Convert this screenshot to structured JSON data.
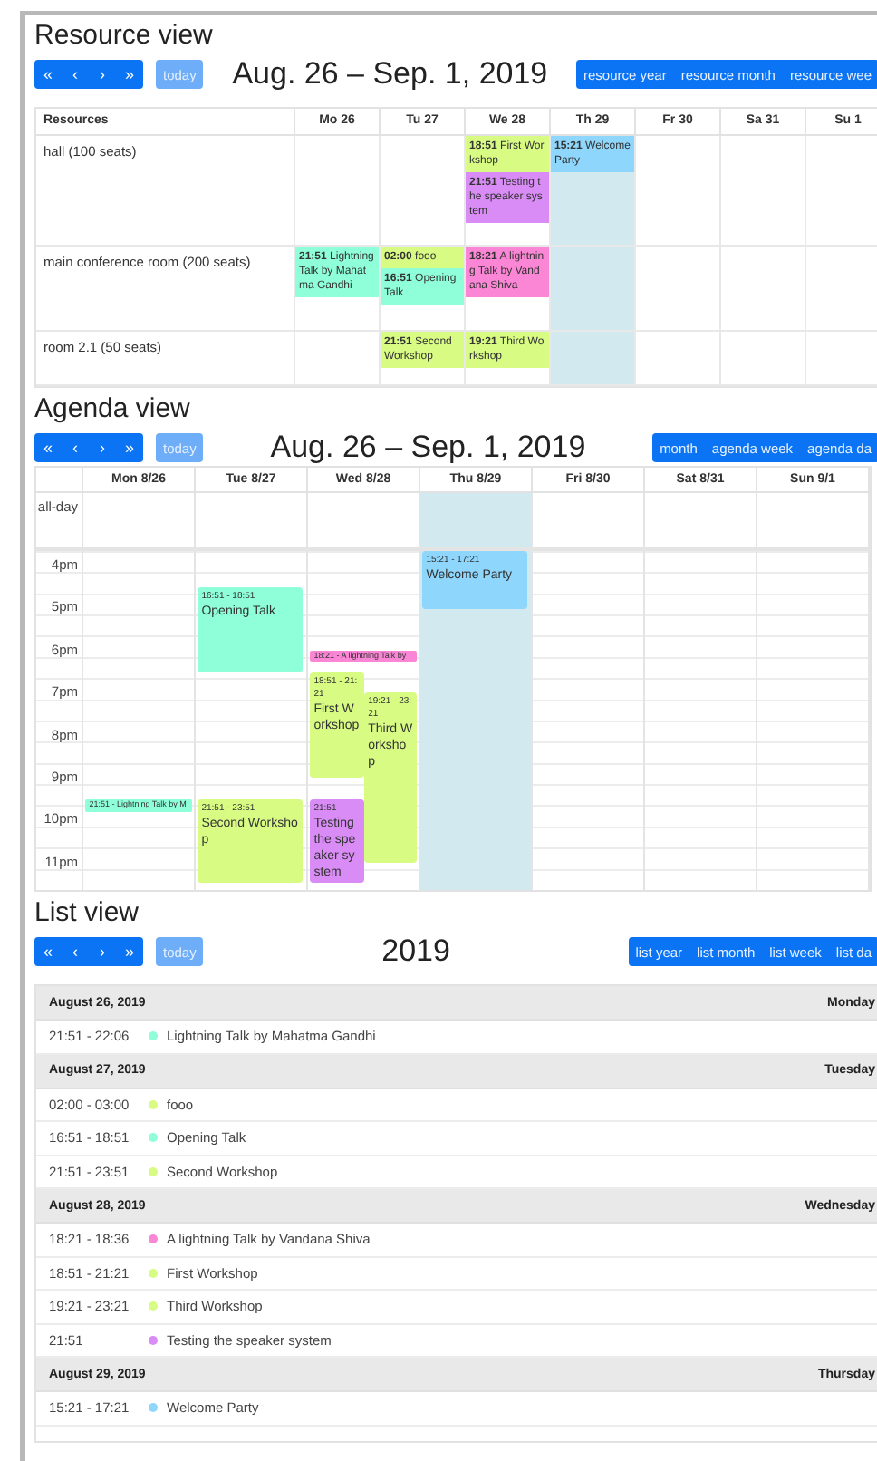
{
  "resource_view": {
    "title": "Resource view",
    "nav_buttons": [
      "«",
      "‹",
      "›",
      "»"
    ],
    "today_button": {
      "label": "today",
      "disabled": true
    },
    "date_range": "Aug. 26 – Sep. 1, 2019",
    "view_buttons": [
      {
        "label": "resource year",
        "selected": false
      },
      {
        "label": "resource month",
        "selected": false
      },
      {
        "label": "resource wee",
        "selected": false
      }
    ],
    "table": {
      "resource_header": "Resources",
      "days": [
        {
          "label": "Mo 26",
          "today": false
        },
        {
          "label": "Tu 27",
          "today": false
        },
        {
          "label": "We 28",
          "today": false
        },
        {
          "label": "Th 29",
          "today": true
        },
        {
          "label": "Fr 30",
          "today": false
        },
        {
          "label": "Sa 31",
          "today": false
        },
        {
          "label": "Su 1",
          "today": false
        }
      ],
      "rows": [
        {
          "resource": "hall (100 seats)",
          "cells": [
            {},
            {},
            {
              "events": [
                {
                  "time": "18:51",
                  "title": "First Workshop",
                  "color": "#d8fb84"
                },
                {
                  "time": "21:51",
                  "title": "Testing the speaker system",
                  "color": "#d98cf5"
                }
              ]
            },
            {
              "events": [
                {
                  "time": "15:21",
                  "title": "Welcome Party",
                  "color": "#8ed6fb"
                }
              ]
            },
            {},
            {},
            {}
          ]
        },
        {
          "resource": "main conference room (200 seats)",
          "cells": [
            {
              "events": [
                {
                  "time": "21:51",
                  "title": "Lightning Talk by Mahatma Gandhi",
                  "color": "#8effd9"
                }
              ]
            },
            {
              "events": [
                {
                  "time": "02:00",
                  "title": "fooo",
                  "color": "#d8fb84"
                },
                {
                  "time": "16:51",
                  "title": "Opening Talk",
                  "color": "#8effd9"
                }
              ]
            },
            {
              "events": [
                {
                  "time": "18:21",
                  "title": "A lightning Talk by Vandana Shiva",
                  "color": "#fb86d6"
                }
              ]
            },
            {},
            {},
            {},
            {}
          ]
        },
        {
          "resource": "room 2.1 (50 seats)",
          "cells": [
            {},
            {
              "events": [
                {
                  "time": "21:51",
                  "title": "Second Workshop",
                  "color": "#d8fb84"
                }
              ]
            },
            {
              "events": [
                {
                  "time": "19:21",
                  "title": "Third Workshop",
                  "color": "#d8fb84"
                }
              ]
            },
            {},
            {},
            {},
            {}
          ]
        }
      ]
    }
  },
  "agenda_view": {
    "title": "Agenda view",
    "nav_buttons": [
      "«",
      "‹",
      "›",
      "»"
    ],
    "today_button": {
      "label": "today",
      "disabled": true
    },
    "date_range": "Aug. 26 – Sep. 1, 2019",
    "view_buttons": [
      {
        "label": "month",
        "selected": false
      },
      {
        "label": "agenda week",
        "selected": false
      },
      {
        "label": "agenda da",
        "selected": false
      }
    ],
    "all_day_label": "all-day",
    "hours": [
      "4pm",
      "5pm",
      "6pm",
      "7pm",
      "8pm",
      "9pm",
      "10pm",
      "11pm"
    ],
    "days": [
      {
        "label": "Mon 8/26",
        "today": false,
        "events": [
          {
            "kind": "compact",
            "label": "21:51 - Lightning Talk by M",
            "color": "#8effd9"
          }
        ]
      },
      {
        "label": "Tue 8/27",
        "today": false,
        "events": [
          {
            "kind": "block",
            "time": "16:51 - 18:51",
            "title": "Opening Talk",
            "color": "#8effd9"
          },
          {
            "kind": "block",
            "time": "21:51 - 23:51",
            "title": "Second Workshop",
            "color": "#d8fb84"
          }
        ]
      },
      {
        "label": "Wed 8/28",
        "today": false,
        "events": [
          {
            "kind": "compact",
            "label": "18:21 - A lightning Talk by",
            "color": "#fb86d6"
          },
          {
            "kind": "block",
            "time": "18:51 - 21:21",
            "title": "First Workshop",
            "color": "#d8fb84"
          },
          {
            "kind": "block",
            "time": "19:21 - 23:21",
            "title": "Third Workshop",
            "color": "#d8fb84"
          },
          {
            "kind": "block",
            "time": "21:51",
            "title": "Testing the speaker system",
            "color": "#d98cf5"
          }
        ]
      },
      {
        "label": "Thu 8/29",
        "today": true,
        "events": [
          {
            "kind": "block",
            "time": "15:21 - 17:21",
            "title": "Welcome Party",
            "color": "#8ed6fb"
          }
        ]
      },
      {
        "label": "Fri 8/30",
        "today": false
      },
      {
        "label": "Sat 8/31",
        "today": false
      },
      {
        "label": "Sun 9/1",
        "today": false
      }
    ]
  },
  "list_view": {
    "title": "List view",
    "nav_buttons": [
      "«",
      "‹",
      "›",
      "»"
    ],
    "today_button": {
      "label": "today",
      "disabled": true
    },
    "date_range": "2019",
    "view_buttons": [
      {
        "label": "list year",
        "selected": false
      },
      {
        "label": "list month",
        "selected": false
      },
      {
        "label": "list week",
        "selected": false
      },
      {
        "label": "list da",
        "selected": false
      }
    ],
    "groups": [
      {
        "date": "August 26, 2019",
        "weekday": "Monday",
        "events": [
          {
            "time": "21:51 - 22:06",
            "title": "Lightning Talk by Mahatma Gandhi",
            "color": "#8effd9"
          }
        ]
      },
      {
        "date": "August 27, 2019",
        "weekday": "Tuesday",
        "events": [
          {
            "time": "02:00 - 03:00",
            "title": "fooo",
            "color": "#d8fb84"
          },
          {
            "time": "16:51 - 18:51",
            "title": "Opening Talk",
            "color": "#8effd9"
          },
          {
            "time": "21:51 - 23:51",
            "title": "Second Workshop",
            "color": "#d8fb84"
          }
        ]
      },
      {
        "date": "August 28, 2019",
        "weekday": "Wednesday",
        "events": [
          {
            "time": "18:21 - 18:36",
            "title": "A lightning Talk by Vandana Shiva",
            "color": "#fb86d6"
          },
          {
            "time": "18:51 - 21:21",
            "title": "First Workshop",
            "color": "#d8fb84"
          },
          {
            "time": "19:21 - 23:21",
            "title": "Third Workshop",
            "color": "#d8fb84"
          },
          {
            "time": "21:51",
            "title": "Testing the speaker system",
            "color": "#d98cf5"
          }
        ]
      },
      {
        "date": "August 29, 2019",
        "weekday": "Thursday",
        "events": [
          {
            "time": "15:21 - 17:21",
            "title": "Welcome Party",
            "color": "#8ed6fb"
          }
        ]
      }
    ]
  }
}
